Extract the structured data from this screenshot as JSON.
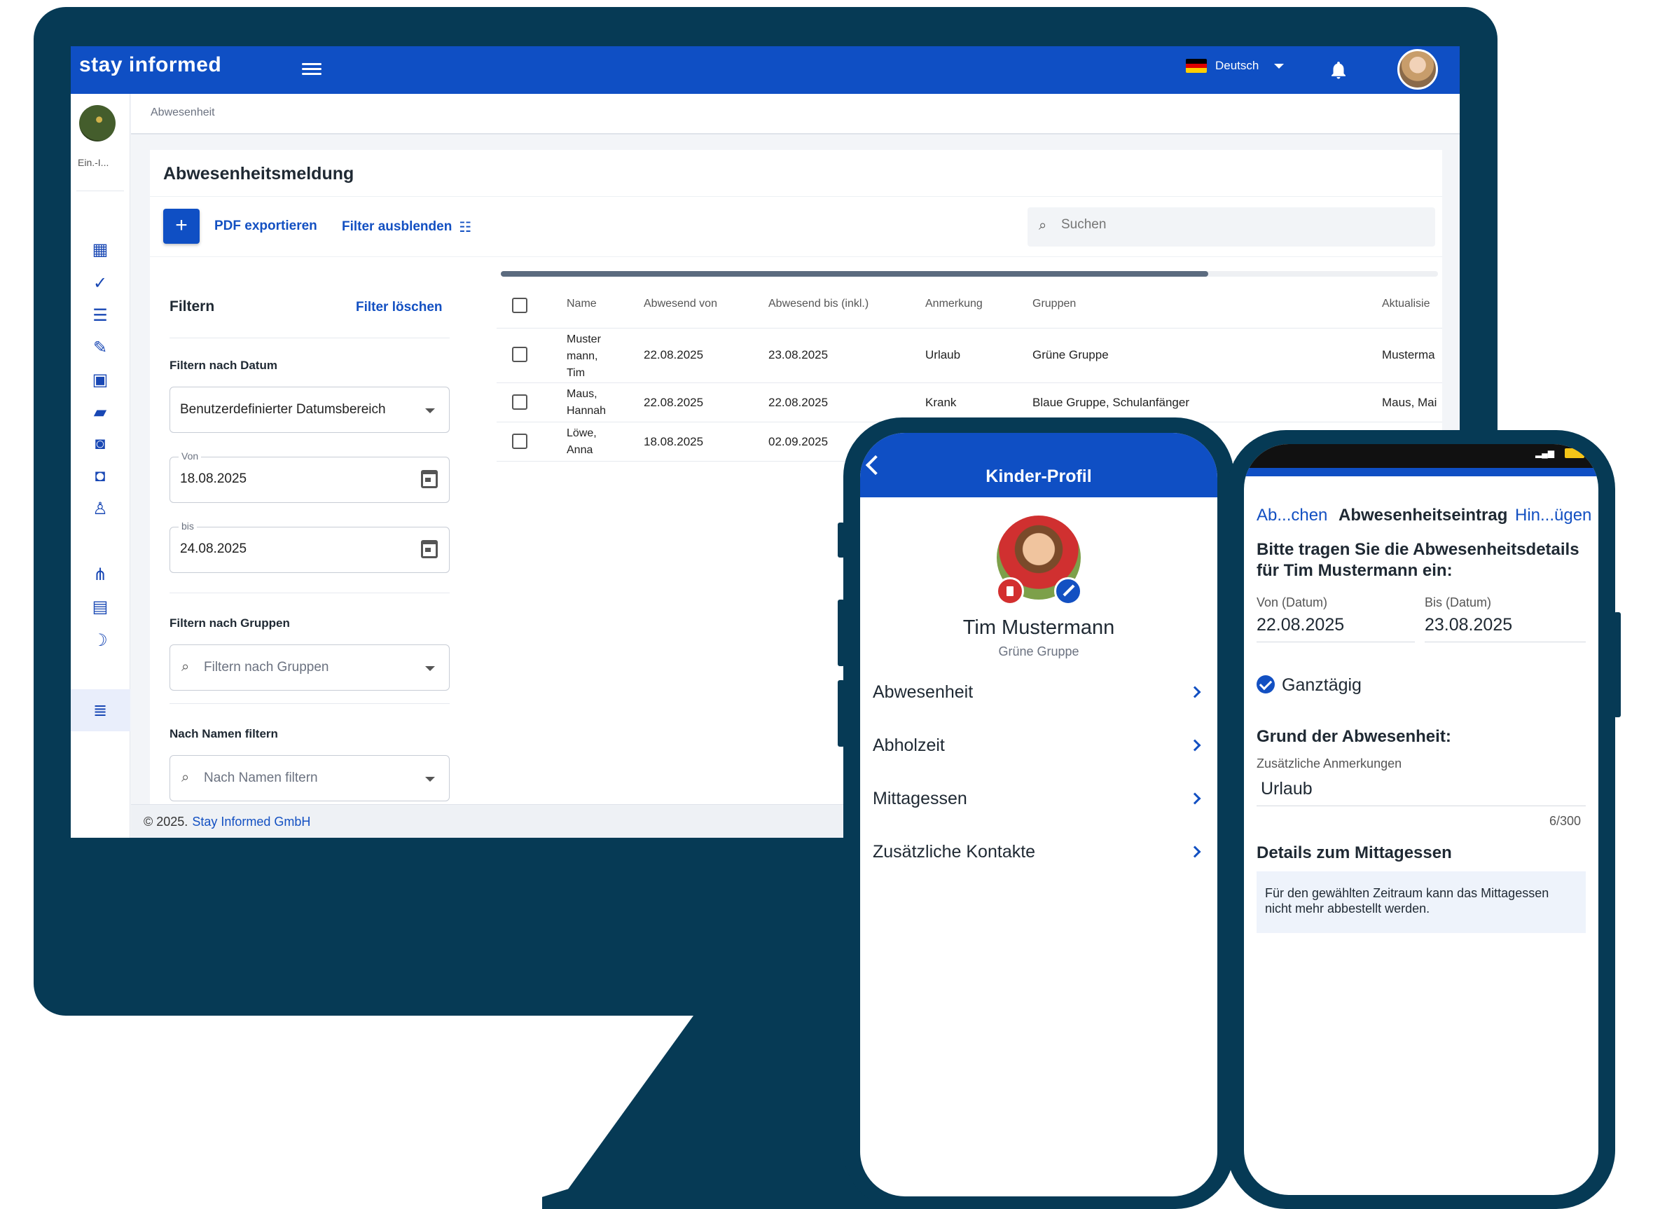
{
  "desktop": {
    "app_logo": "stay informed",
    "language": "Deutsch",
    "breadcrumb": "Abwesenheit",
    "sidebar_caption": "Ein.-I...",
    "card_title": "Abwesenheitsmeldung",
    "add_button": "+",
    "export_label": "PDF exportieren",
    "toggle_filter_label": "Filter ausblenden",
    "search_placeholder": "Suchen",
    "filters": {
      "title": "Filtern",
      "clear_label": "Filter löschen",
      "date_label": "Filtern nach Datum",
      "date_range_value": "Benutzerdefinierter Datumsbereich",
      "from_legend": "Von",
      "from_value": "18.08.2025",
      "to_legend": "bis",
      "to_value": "24.08.2025",
      "groups_label": "Filtern nach Gruppen",
      "groups_placeholder": "Filtern nach Gruppen",
      "name_label": "Nach Namen filtern",
      "name_placeholder": "Nach Namen filtern"
    },
    "table": {
      "columns": [
        "Name",
        "Abwesend von",
        "Abwesend bis (inkl.)",
        "Anmerkung",
        "Gruppen",
        "Aktualisie"
      ],
      "rows": [
        {
          "name_1": "Muster",
          "name_2": "mann,",
          "name_3": "Tim",
          "from": "22.08.2025",
          "to": "23.08.2025",
          "note": "Urlaub",
          "groups": "Grüne Gruppe",
          "updated": "Musterma"
        },
        {
          "name_1": "Maus,",
          "name_2": "Hannah",
          "from": "22.08.2025",
          "to": "22.08.2025",
          "note": "Krank",
          "groups": "Blaue Gruppe, Schulanfänger",
          "updated": "Maus, Mai"
        },
        {
          "name_1": "Löwe,",
          "name_2": "Anna",
          "from": "18.08.2025",
          "to": "02.09.2025",
          "note": "",
          "groups": "",
          "updated": ""
        }
      ]
    },
    "footer": {
      "copyright": "© 2025.",
      "company": "Stay Informed GmbH"
    }
  },
  "phone_profile": {
    "title": "Kinder-Profil",
    "child_name": "Tim Mustermann",
    "child_group": "Grüne Gruppe",
    "menu": [
      "Abwesenheit",
      "Abholzeit",
      "Mittagessen",
      "Zusätzliche Kontakte"
    ]
  },
  "phone_absence": {
    "nav_cancel": "Ab...chen",
    "nav_title": "Abwesenheitseintrag",
    "nav_add": "Hin...ügen",
    "instruction_1": "Bitte tragen Sie die Abwesenheitsdetails",
    "instruction_2": "für Tim Mustermann  ein:",
    "from_label": "Von (Datum)",
    "from_value": "22.08.2025",
    "to_label": "Bis (Datum)",
    "to_value": "23.08.2025",
    "allday_label": "Ganztägig",
    "reason_heading": "Grund der Abwesenheit:",
    "notes_label": "Zusätzliche Anmerkungen",
    "notes_value": "Urlaub",
    "char_count": "6/300",
    "lunch_heading": "Details zum Mittagessen",
    "lunch_info_1": "Für den gewählten Zeitraum kann das Mittagessen",
    "lunch_info_2": "nicht mehr abbestellt werden."
  },
  "colors": {
    "brand_blue": "#0f4fc4",
    "device_navy": "#063a55",
    "link_blue": "#1350c2"
  }
}
